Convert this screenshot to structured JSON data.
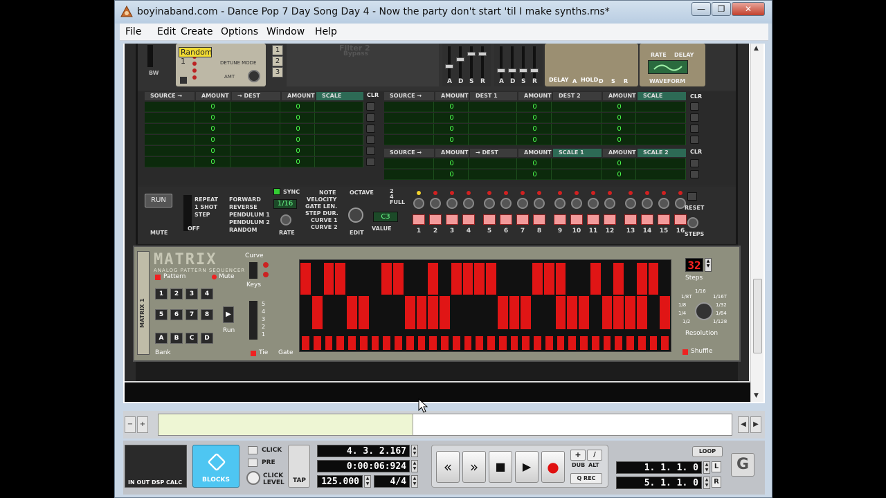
{
  "window": {
    "title": "boyinaband.com - Dance Pop 7 Day Song Day 4 - Now the party don't start 'til I make synths.rns*",
    "min_label": "—",
    "max_label": "❐",
    "close_label": "✕"
  },
  "menu": [
    "File",
    "Edit",
    "Create",
    "Options",
    "Window",
    "Help"
  ],
  "thor": {
    "random_display": "Random 1",
    "detune_label": "DETUNE MODE",
    "amt_label": "AMT",
    "bw_label": "BW",
    "num_buttons": [
      "1",
      "2",
      "3"
    ],
    "filter2_label": "Filter 2",
    "bypass_label": "Bypass",
    "adsr_letters": [
      "A",
      "D",
      "S",
      "R"
    ],
    "delay_labels": [
      "DELAY",
      "A",
      "HOLD",
      "D",
      "S",
      "R"
    ],
    "rate_label": "RATE",
    "delay_label2": "DELAY",
    "waveform_label": "WAVEFORM",
    "mod_headers_left": [
      "SOURCE →",
      "AMOUNT",
      "→ DEST",
      "AMOUNT",
      "SCALE"
    ],
    "mod_headers_right_top": [
      "SOURCE →",
      "AMOUNT",
      "DEST 1",
      "AMOUNT",
      "DEST 2",
      "AMOUNT",
      "SCALE"
    ],
    "mod_headers_right_bottom": [
      "SOURCE →",
      "AMOUNT",
      "→ DEST",
      "AMOUNT",
      "SCALE 1",
      "AMOUNT",
      "SCALE 2"
    ],
    "clr_label": "CLR",
    "zero": "0",
    "run_label": "RUN",
    "mute_label": "MUTE",
    "off_label": "OFF",
    "mode_options": [
      "REPEAT",
      "1 SHOT",
      "STEP"
    ],
    "direction_options": [
      "FORWARD",
      "REVERSE",
      "PENDULUM 1",
      "PENDULUM 2",
      "RANDOM"
    ],
    "sync_label": "SYNC",
    "rate_value": "1/16",
    "rate_knob_label": "RATE",
    "edit_options": [
      "NOTE",
      "VELOCITY",
      "GATE LEN.",
      "STEP DUR.",
      "CURVE 1",
      "CURVE 2"
    ],
    "edit_label": "EDIT",
    "octave_label": "OCTAVE",
    "octave_options": [
      "2",
      "4",
      "FULL"
    ],
    "value_display": "C3",
    "value_label": "VALUE",
    "step_numbers": [
      "1",
      "2",
      "3",
      "4",
      "5",
      "6",
      "7",
      "8",
      "9",
      "10",
      "11",
      "12",
      "13",
      "14",
      "15",
      "16"
    ],
    "reset_label": "RESET",
    "steps_label": "STEPS"
  },
  "matrix": {
    "logo": "MATRIX",
    "subtitle": "ANALOG PATTERN SEQUENCER",
    "side_label": "MATRIX 1",
    "pattern_label": "Pattern",
    "mute_label": "Mute",
    "pattern_keys": [
      "1",
      "2",
      "3",
      "4",
      "5",
      "6",
      "7",
      "8"
    ],
    "bank_keys": [
      "A",
      "B",
      "C",
      "D"
    ],
    "bank_label": "Bank",
    "run_label": "Run",
    "curve_label": "Curve",
    "keys_label": "Keys",
    "octave_numbers": [
      "5",
      "4",
      "3",
      "2",
      "1"
    ],
    "tie_label": "Tie",
    "gate_label": "Gate",
    "steps_value": "32",
    "steps_label": "Steps",
    "resolution_options": [
      "1/8T",
      "1/16",
      "1/16T",
      "1/8",
      "1/32",
      "1/4",
      "1/64",
      "1/2",
      "1/128"
    ],
    "resolution_label": "Resolution",
    "shuffle_label": "Shuffle",
    "grid_top": [
      1,
      0,
      1,
      1,
      0,
      0,
      0,
      1,
      1,
      0,
      0,
      1,
      0,
      1,
      1,
      1,
      1,
      0,
      0,
      0,
      1,
      1,
      1,
      0,
      0,
      1,
      0,
      1,
      0,
      1,
      1,
      0
    ],
    "grid_bottom": [
      0,
      1,
      0,
      0,
      1,
      1,
      0,
      0,
      0,
      1,
      1,
      1,
      1,
      0,
      0,
      0,
      0,
      1,
      1,
      1,
      0,
      0,
      1,
      1,
      1,
      0,
      1,
      1,
      1,
      1,
      0,
      1
    ],
    "gate_row": [
      1,
      1,
      1,
      1,
      1,
      1,
      1,
      1,
      1,
      1,
      1,
      1,
      1,
      1,
      1,
      1,
      1,
      1,
      1,
      1,
      1,
      1,
      1,
      1,
      1,
      1,
      1,
      1,
      1,
      1,
      1,
      1
    ]
  },
  "transport": {
    "cpu_labels": "IN  OUT  DSP  CALC",
    "blocks_label": "BLOCKS",
    "click_label": "CLICK",
    "pre_label": "PRE",
    "click_level_label": "CLICK LEVEL",
    "tap_label": "TAP",
    "position": "4. 3. 2.167",
    "time": "0:00:06:924",
    "tempo": "125.000",
    "signature": "4/4",
    "rewind_label": "«",
    "ffwd_label": "»",
    "stop_label": "■",
    "play_label": "▶",
    "record_label": "●",
    "plus_label": "+",
    "slash_label": "/",
    "dub_label": "DUB",
    "alt_label": "ALT",
    "qrec_label": "Q REC",
    "loop_label": "LOOP",
    "left_locator": "1. 1. 1.   0",
    "right_locator": "5. 1. 1.   0",
    "l_label": "L",
    "r_label": "R",
    "g_label": "G"
  },
  "colors": {
    "grid_on": "#e01515",
    "lcd_green": "#6bff8c",
    "blocks_blue": "#4ec6f2"
  }
}
